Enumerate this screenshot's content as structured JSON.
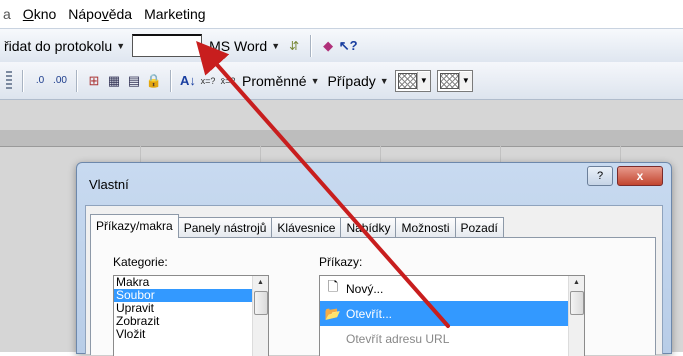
{
  "menubar": {
    "items": [
      {
        "label": "a"
      },
      {
        "label": "Okno"
      },
      {
        "label": "Nápověda"
      },
      {
        "label": "Marketing"
      }
    ]
  },
  "toolbar1": {
    "add_to_log": "řidat do protokolu",
    "ms_word": "MS Word"
  },
  "toolbar2": {
    "variables": "Proměnné",
    "cases": "Případy"
  },
  "dialog": {
    "title": "Vlastní",
    "help": "?",
    "close": "x",
    "tabs": [
      "Příkazy/makra",
      "Panely nástrojů",
      "Klávesnice",
      "Nabídky",
      "Možnosti",
      "Pozadí"
    ],
    "active_tab": "Příkazy/makra",
    "categories_label": "Kategorie:",
    "categories": [
      "Makra",
      "Soubor",
      "Upravit",
      "Zobrazit",
      "Vložit"
    ],
    "selected_category": "Soubor",
    "commands_label": "Příkazy:",
    "commands": [
      "Nový...",
      "Otevřít...",
      "Otevřít adresu URL"
    ],
    "selected_command": "Otevřít..."
  },
  "colors": {
    "accent_arrow": "#c81e1e",
    "selection": "#3399ff",
    "close_button": "#c2452f"
  },
  "icons": {
    "new_doc": "document-icon",
    "open_folder": "folder-open-icon"
  }
}
